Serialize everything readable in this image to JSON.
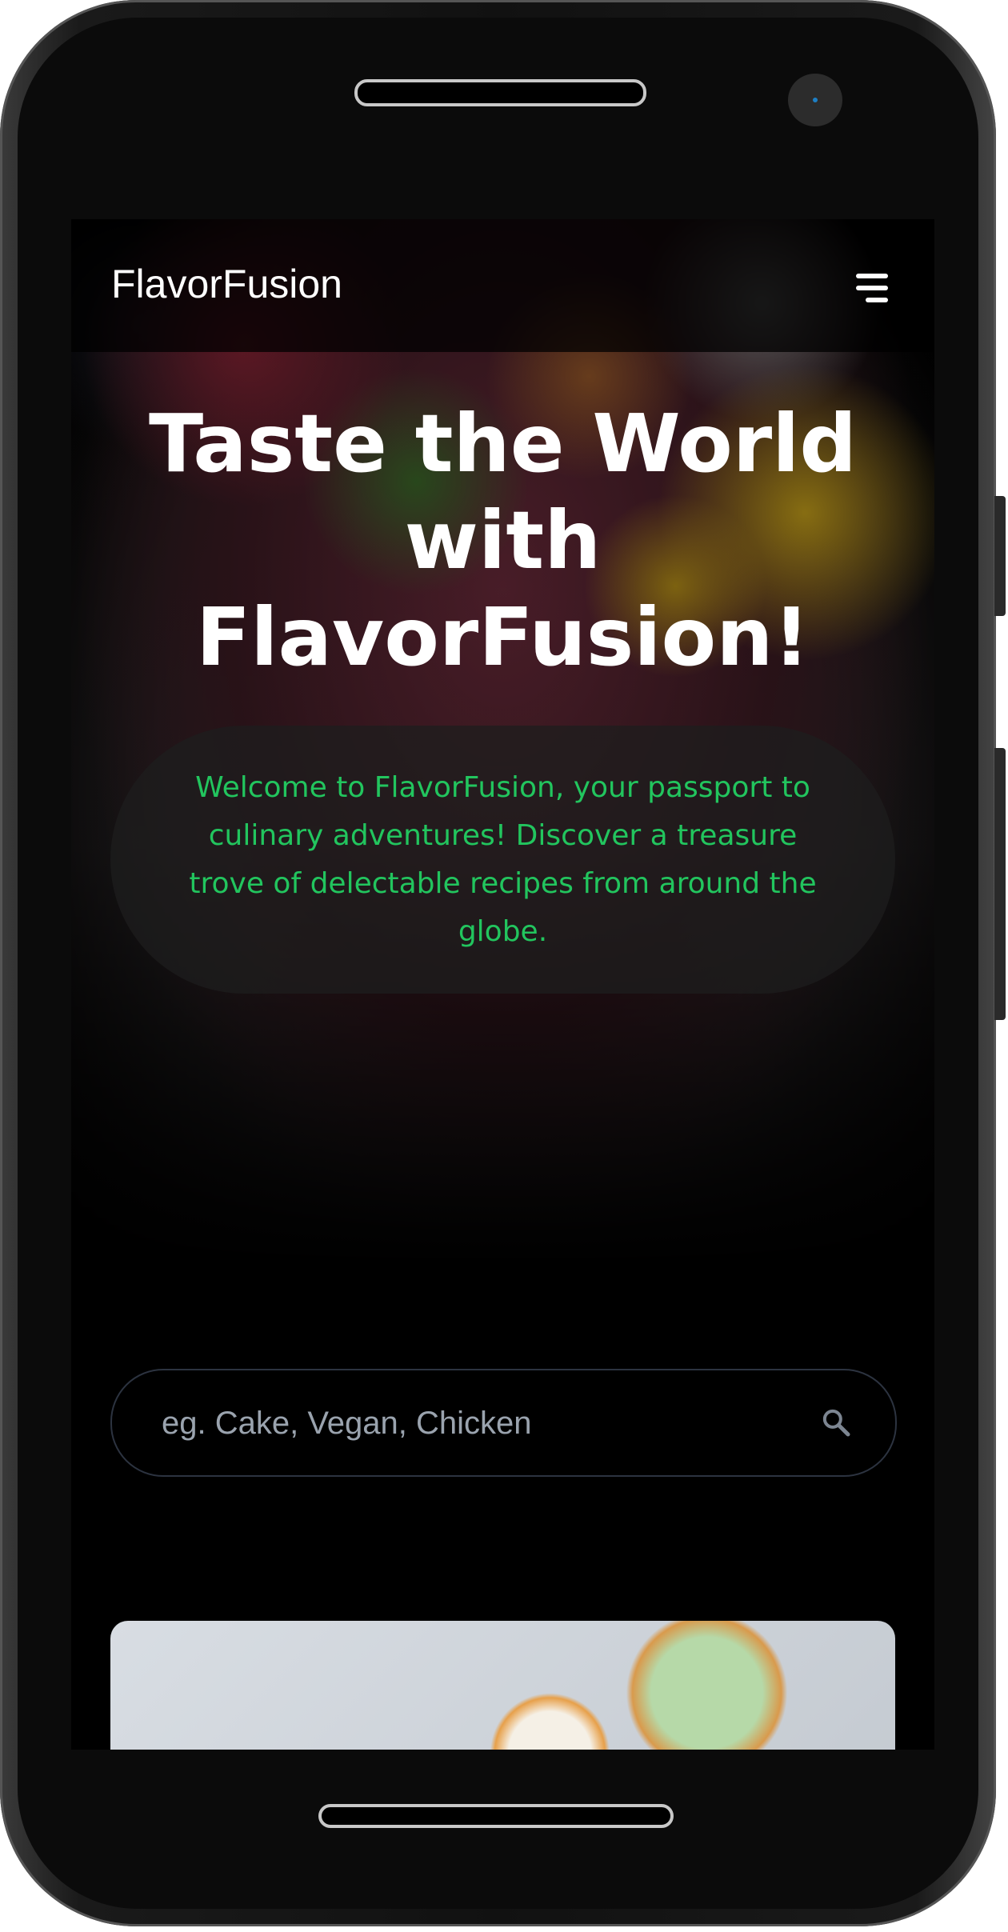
{
  "app": {
    "brand": "FlavorFusion",
    "menu_icon": "hamburger-icon"
  },
  "hero": {
    "title": "Taste the World with FlavorFusion!",
    "intro": "Welcome to FlavorFusion, your passport to culinary adventures! Discover a treasure trove of delectable recipes from around the globe."
  },
  "search": {
    "placeholder": "eg. Cake, Vegan, Chicken",
    "value": "",
    "icon": "search-icon"
  },
  "colors": {
    "accent": "#22c55e",
    "background": "#000000"
  }
}
